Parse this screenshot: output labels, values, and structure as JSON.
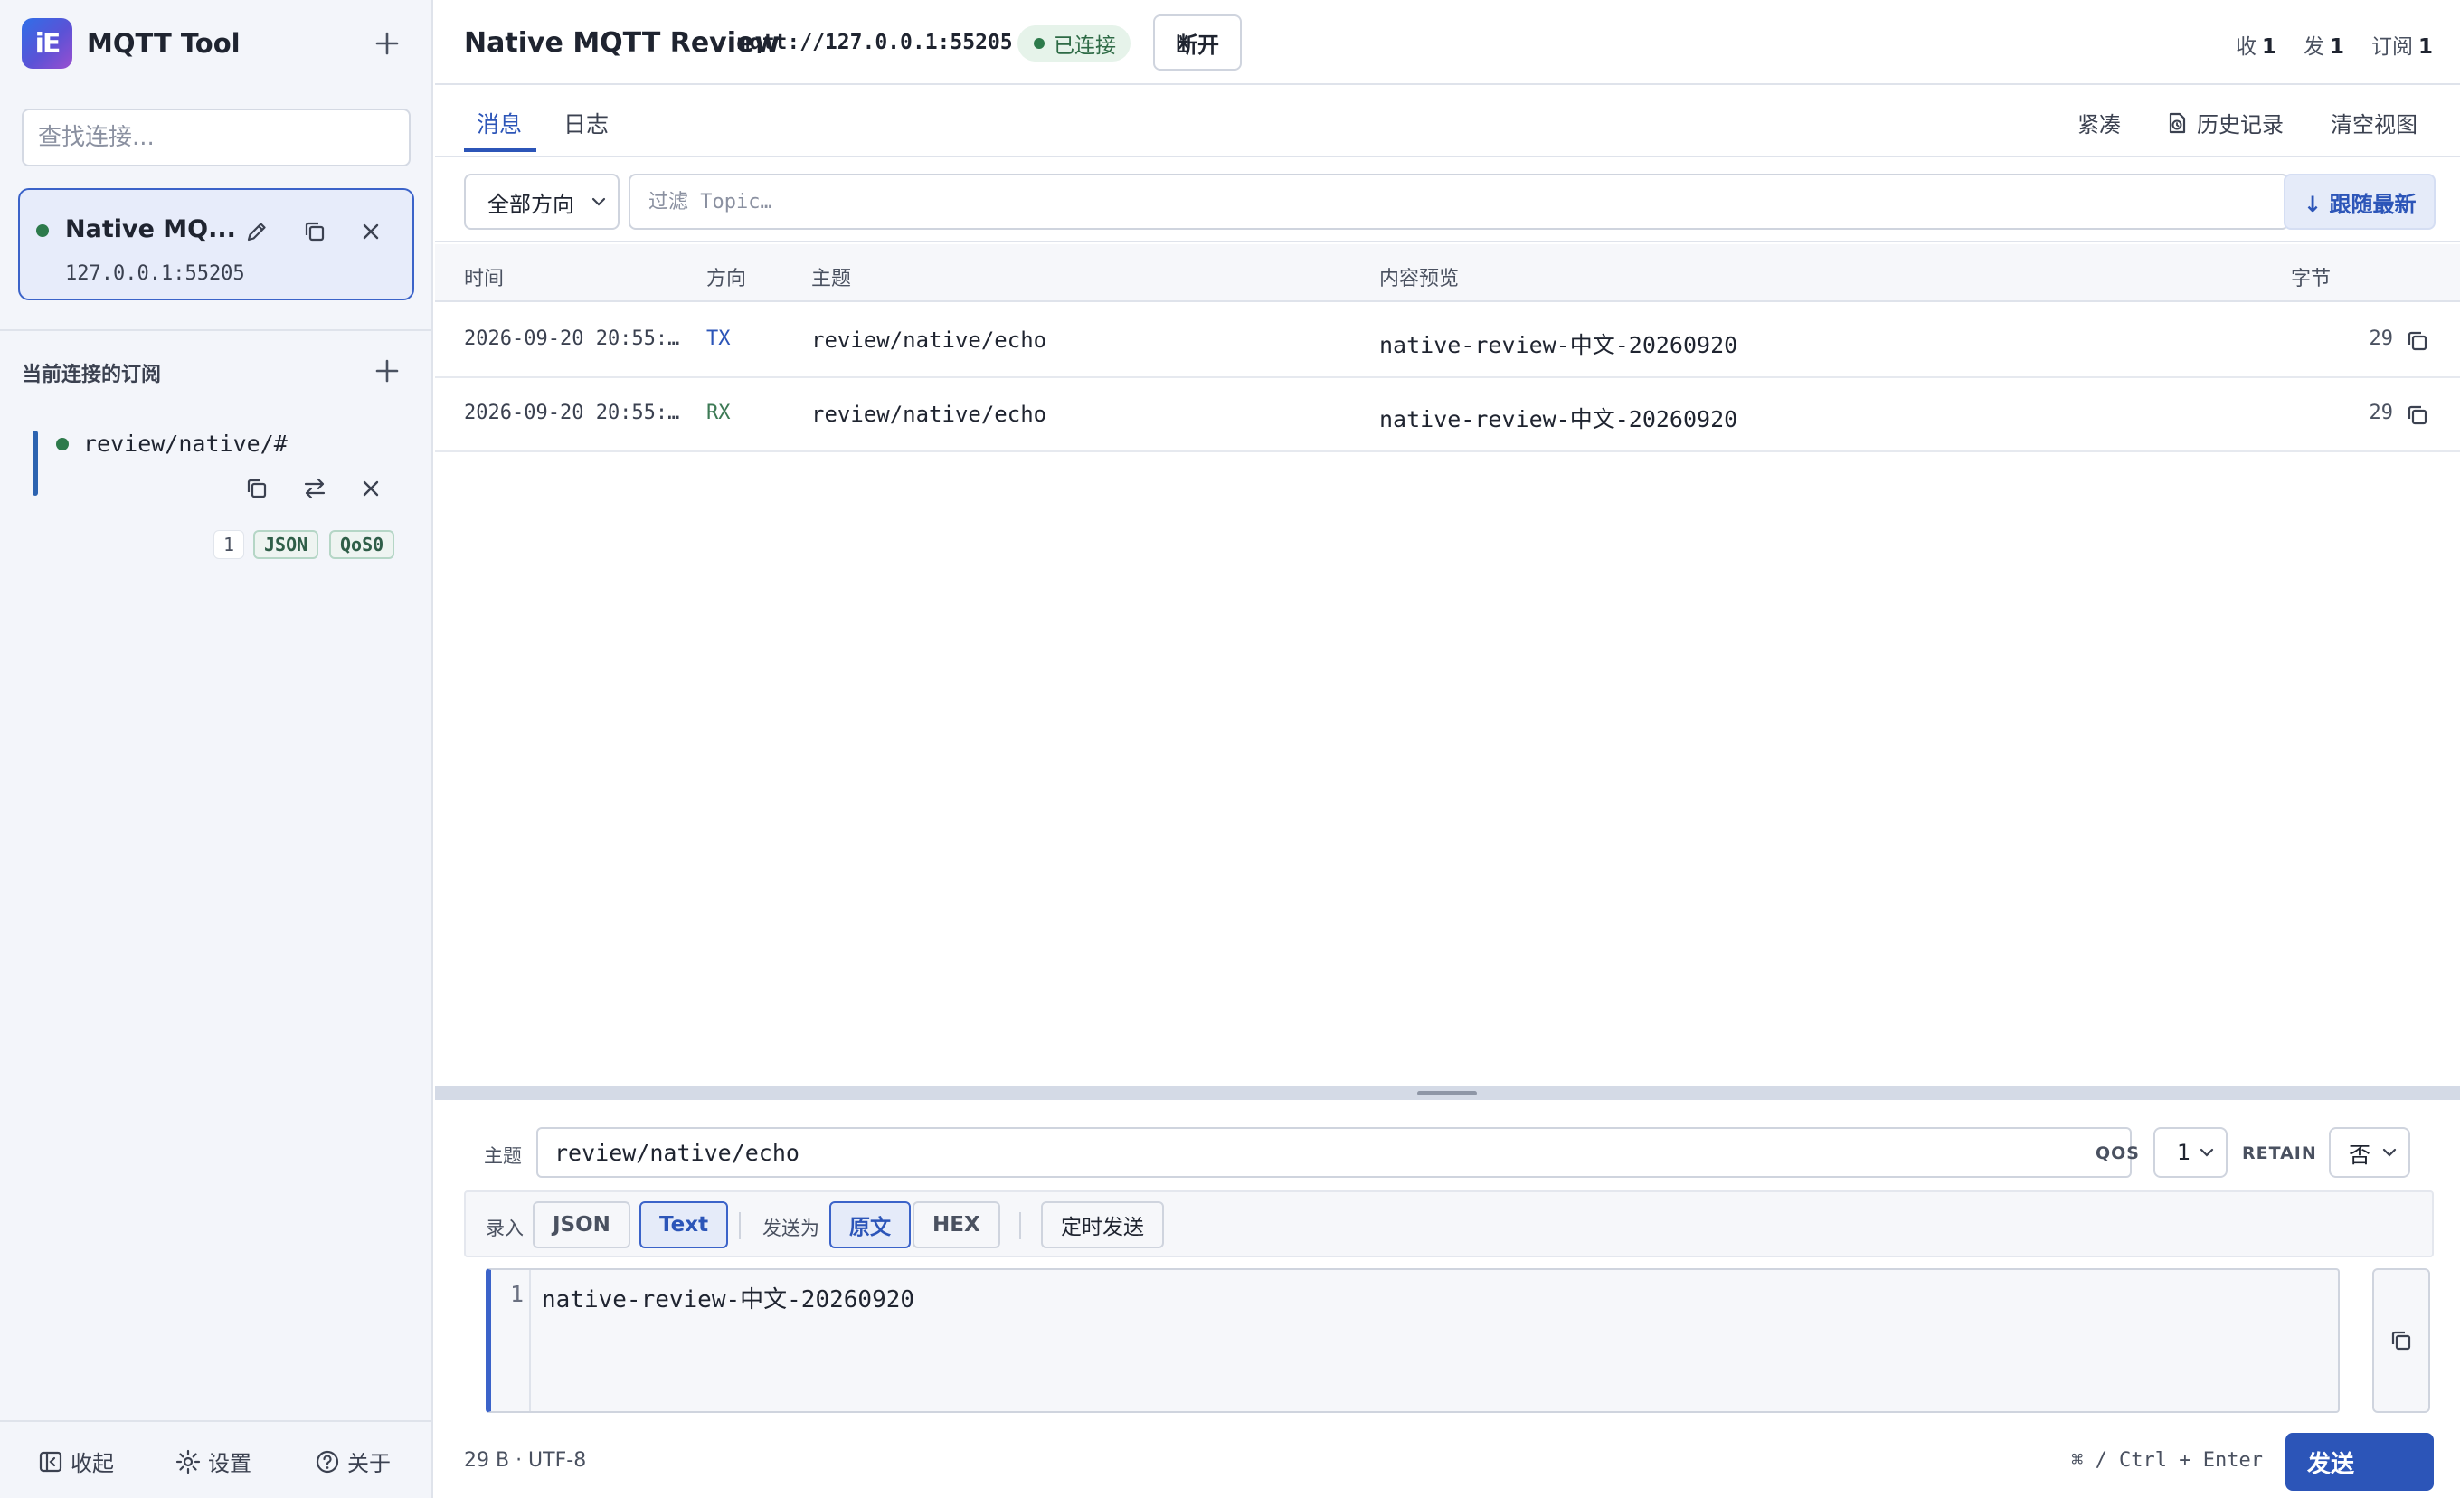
{
  "app": {
    "name": "MQTT Tool",
    "logo_text": "iE"
  },
  "sidebar": {
    "search_placeholder": "查找连接...",
    "connection": {
      "name": "Native MQ...",
      "address": "127.0.0.1:55205",
      "status_color": "#2d7a4b"
    },
    "subscriptions_title": "当前连接的订阅",
    "subscription": {
      "topic": "review/native/#",
      "count": "1",
      "format": "JSON",
      "qos": "QoS0"
    },
    "footer": {
      "collapse": "收起",
      "settings": "设置",
      "about": "关于"
    }
  },
  "header": {
    "title": "Native MQTT Review",
    "url": "mqtt://127.0.0.1:55205",
    "status": "已连接",
    "disconnect": "断开",
    "counters": {
      "recv_label": "收",
      "recv": "1",
      "sent_label": "发",
      "sent": "1",
      "subs_label": "订阅",
      "subs": "1"
    }
  },
  "tabs": {
    "messages": "消息",
    "logs": "日志"
  },
  "toolbar": {
    "compact": "紧凑",
    "history": "历史记录",
    "clear": "清空视图"
  },
  "filter": {
    "direction": "全部方向",
    "topic_placeholder": "过滤 Topic…",
    "follow": "↓ 跟随最新"
  },
  "table": {
    "headers": {
      "time": "时间",
      "direction": "方向",
      "topic": "主题",
      "preview": "内容预览",
      "bytes": "字节"
    },
    "rows": [
      {
        "time": "2026-09-20 20:55:…",
        "direction": "TX",
        "topic": "review/native/echo",
        "preview": "native-review-中文-20260920",
        "bytes": "29"
      },
      {
        "time": "2026-09-20 20:55:…",
        "direction": "RX",
        "topic": "review/native/echo",
        "preview": "native-review-中文-20260920",
        "bytes": "29"
      }
    ]
  },
  "composer": {
    "topic_label": "主题",
    "topic_value": "review/native/echo",
    "qos_label": "QOS",
    "qos_value": "1",
    "retain_label": "RETAIN",
    "retain_value": "否",
    "input_label": "录入",
    "input_json": "JSON",
    "input_text": "Text",
    "send_as_label": "发送为",
    "send_raw": "原文",
    "send_hex": "HEX",
    "scheduled": "定时发送",
    "line_number": "1",
    "payload": "native-review-中文-20260920",
    "meta": "29 B · UTF-8",
    "shortcut": "⌘ / Ctrl + Enter",
    "send": "发送"
  },
  "colors": {
    "accent": "#2c55b8",
    "connected": "#2d7a4b",
    "tx": "#2c55b8",
    "rx": "#3d7a55"
  }
}
